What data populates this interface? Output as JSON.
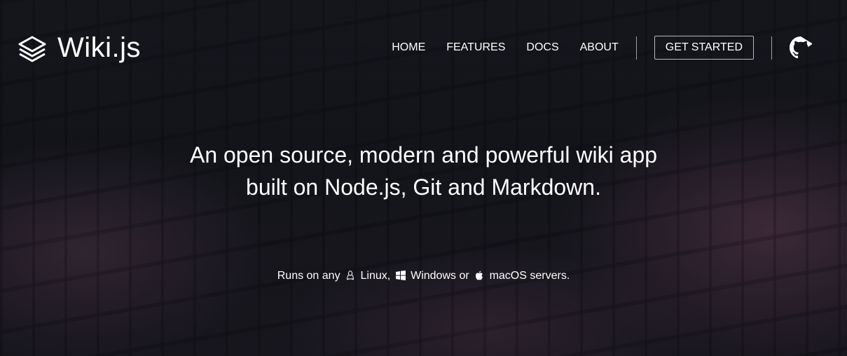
{
  "brand": {
    "name": "Wiki.js",
    "icon": "layers-icon"
  },
  "nav": {
    "items": [
      "HOME",
      "FEATURES",
      "DOCS",
      "ABOUT"
    ],
    "cta": "GET STARTED",
    "github_icon": "github-icon"
  },
  "hero": {
    "line1": "An open source, modern and powerful wiki app",
    "line2": "built on Node.js, Git and Markdown."
  },
  "platforms": {
    "prefix": "Runs on any",
    "linux": "Linux,",
    "windows": "Windows or",
    "macos": "macOS servers."
  }
}
